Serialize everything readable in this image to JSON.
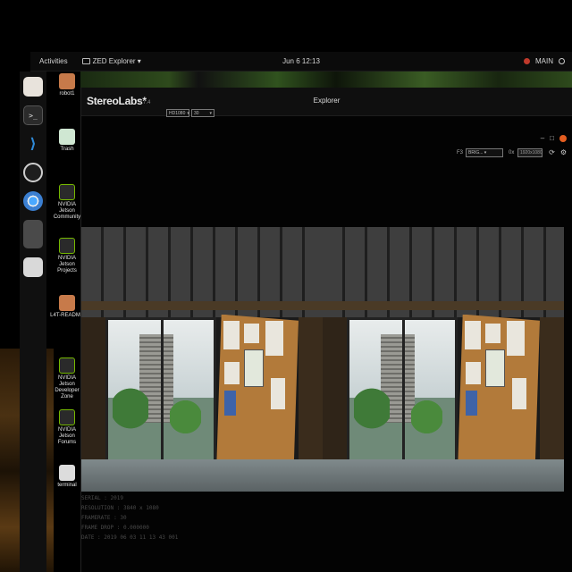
{
  "topbar": {
    "activities": "Activities",
    "app_menu": "ZED Explorer ▾",
    "clock": "Jun 6 12:13",
    "tray_text": "MAIN"
  },
  "dock": {
    "items": [
      "files-icon",
      "terminal-icon",
      "vscode-icon",
      "obs-icon",
      "chrome-icon",
      "app-grid-icon",
      "notes-icon"
    ]
  },
  "desktop": {
    "icons": [
      {
        "label": "robot1",
        "icon": "folder-icon"
      },
      {
        "label": "Trash",
        "icon": "trash-icon"
      },
      {
        "label": "NVIDIA Jetson Community",
        "icon": "nvidia-icon"
      },
      {
        "label": "NVIDIA Jetson Projects",
        "icon": "nvidia-icon"
      },
      {
        "label": "L4T-README",
        "icon": "folder-icon"
      },
      {
        "label": "NVIDIA Jetson Developer Zone",
        "icon": "nvidia-icon"
      },
      {
        "label": "NVIDIA Jetson Forums",
        "icon": "nvidia-icon"
      },
      {
        "label": "terminal",
        "icon": "doc-icon"
      }
    ]
  },
  "window": {
    "brand": "StereoLabs*",
    "version": "3.7.4",
    "title": "Explorer",
    "resolution": "HD1080",
    "fps": "30",
    "controls_symbols": [
      "–",
      "□"
    ],
    "toolbar": {
      "label_a": "F3",
      "mode_select": "BRIG... ▾",
      "label_b": "0x",
      "field_value": "1920x1080"
    }
  },
  "info": {
    "lines": [
      "SERIAL : 2019",
      "RESOLUTION : 3840 x 1080",
      "FRAMERATE : 30",
      "FRAME DROP : 0.000000",
      "DATE : 2019 06 03 11 13 43 001"
    ]
  },
  "colors": {
    "background": "#000000",
    "titlebar": "#0f0f0f",
    "accent_close": "#e45d20",
    "nvidia_green": "#76b900"
  }
}
